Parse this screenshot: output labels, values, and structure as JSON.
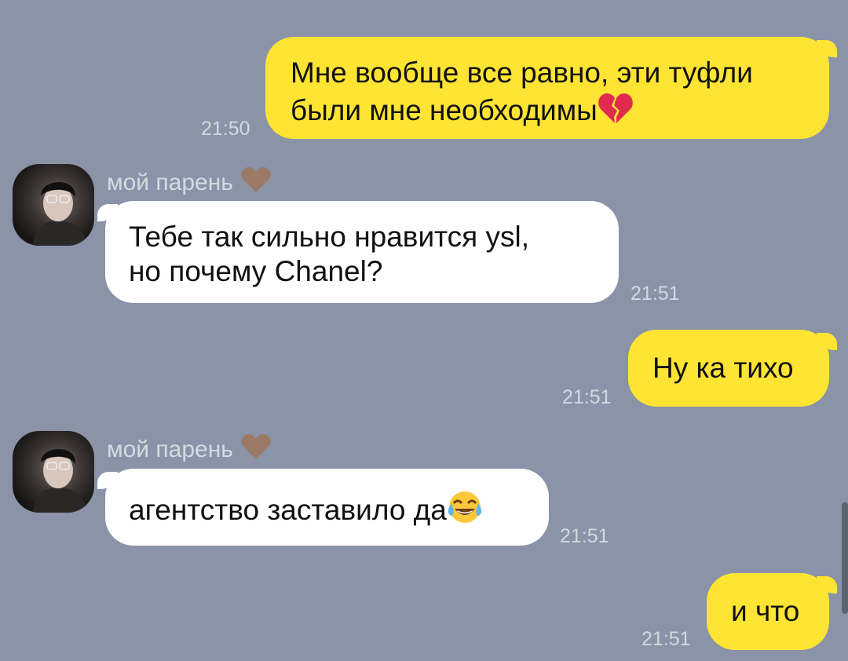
{
  "messages": [
    {
      "text_l1": "Мне вообще все равно, эти туфли",
      "text_l2": "были мне необходимы",
      "emoji": "broken-heart",
      "time": "21:50"
    },
    {
      "sender": "мой парень",
      "sender_emoji": "brown-heart",
      "text_l1": "Тебе так сильно нравится ysl,",
      "text_l2": "но почему Chanel?",
      "time": "21:51"
    },
    {
      "text": "Ну ка тихо",
      "time": "21:51"
    },
    {
      "sender": "мой парень",
      "sender_emoji": "brown-heart",
      "text": "агентство заставило да",
      "emoji": "tears-of-joy",
      "time": "21:51"
    },
    {
      "text": "и что",
      "time": "21:51"
    }
  ],
  "colors": {
    "background": "#8a93a7",
    "outgoing_bubble": "#ffe433",
    "incoming_bubble": "#ffffff"
  }
}
